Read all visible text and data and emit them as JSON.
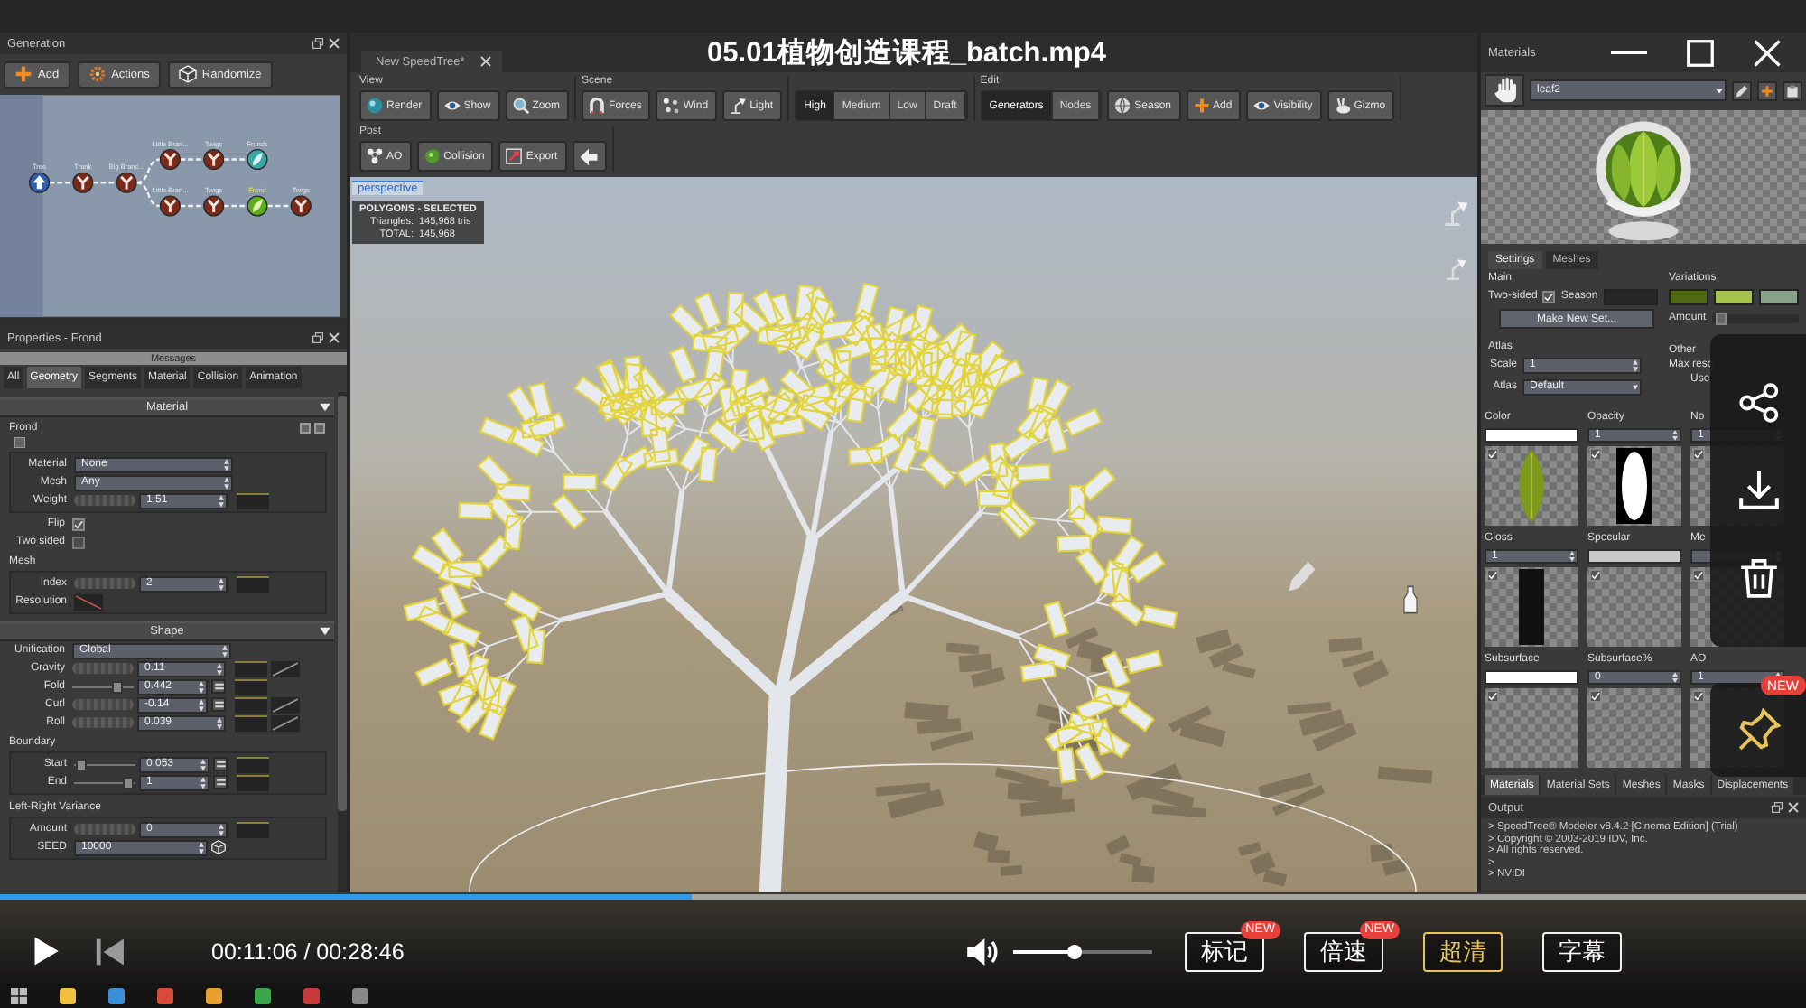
{
  "player": {
    "title": "05.01植物创造课程_batch.mp4",
    "time": "00:11:06 / 00:28:46",
    "progress": {
      "level": 0.383
    },
    "volume": {
      "level": 0.44
    },
    "buttons": [
      {
        "label": "标记",
        "badge": "NEW",
        "selected": false
      },
      {
        "label": "倍速",
        "badge": "NEW",
        "selected": false
      },
      {
        "label": "超清",
        "selected": true
      },
      {
        "label": "字幕",
        "selected": false
      }
    ],
    "pin_badge": "NEW"
  },
  "generation": {
    "title": "Generation",
    "buttons": [
      "Add",
      "Actions",
      "Randomize"
    ],
    "graph": {
      "label": "Tree",
      "kind": "root",
      "selected": false,
      "children": [
        {
          "label": "Trunk",
          "kind": "branch",
          "selected": false,
          "children": [
            {
              "label": "Big Branc...",
              "kind": "branch",
              "selected": false,
              "children": [
                {
                  "label": "Little Bran...",
                  "kind": "branch",
                  "selected": false,
                  "children": [
                    {
                      "label": "Twigs",
                      "kind": "branch",
                      "selected": false,
                      "children": [
                        {
                          "label": "Fronds",
                          "kind": "leaf",
                          "selected": false
                        }
                      ]
                    }
                  ]
                },
                {
                  "label": "Little Bran...",
                  "kind": "branch",
                  "selected": false,
                  "children": [
                    {
                      "label": "Twigs",
                      "kind": "branch",
                      "selected": false,
                      "children": [
                        {
                          "label": "Frond",
                          "kind": "frond",
                          "selected": true,
                          "children": [
                            {
                              "label": "Twigs",
                              "kind": "branch",
                              "selected": false
                            }
                          ]
                        }
                      ]
                    }
                  ]
                }
              ]
            }
          ]
        }
      ]
    }
  },
  "properties": {
    "title": "Properties - Frond",
    "messages": "Messages",
    "tabs": [
      {
        "label": "All",
        "selected": false
      },
      {
        "label": "Geometry",
        "selected": true
      },
      {
        "label": "Segments",
        "selected": false
      },
      {
        "label": "Material",
        "selected": false
      },
      {
        "label": "Collision",
        "selected": false
      },
      {
        "label": "Animation",
        "selected": false
      }
    ],
    "sections": [
      {
        "title": "Material",
        "expanded": true,
        "items": [
          {
            "kind": "group",
            "title": "Frond",
            "tools": true,
            "rows": [
              {
                "kind": "dropdown",
                "label": "Material",
                "value": "None"
              },
              {
                "kind": "dropdown",
                "label": "Mesh",
                "value": "Any"
              },
              {
                "kind": "spin",
                "label": "Weight",
                "value": "1.51",
                "link": false,
                "graph": false
              }
            ]
          },
          {
            "kind": "check",
            "label": "Flip",
            "checked": true
          },
          {
            "kind": "check",
            "label": "Two sided",
            "checked": false
          },
          {
            "kind": "group",
            "title": "Mesh",
            "tools": false,
            "rows": [
              {
                "kind": "spin",
                "label": "Index",
                "value": "2",
                "link": false,
                "graph": false
              },
              {
                "kind": "curve",
                "label": "Resolution"
              }
            ]
          }
        ]
      },
      {
        "title": "Shape",
        "expanded": true,
        "items": [
          {
            "kind": "dropdown",
            "label": "Unification",
            "value": "Global"
          },
          {
            "kind": "spin",
            "label": "Gravity",
            "value": "0.11",
            "link": false,
            "graph": true
          },
          {
            "kind": "slider",
            "label": "Fold",
            "value": "0.442",
            "level": 0.8,
            "link": true,
            "graph": false
          },
          {
            "kind": "spin",
            "label": "Curl",
            "value": "-0.14",
            "link": true,
            "graph": true
          },
          {
            "kind": "spin",
            "label": "Roll",
            "value": "0.039",
            "link": false,
            "graph": true
          },
          {
            "kind": "group",
            "title": "Boundary",
            "tools": false,
            "rows": [
              {
                "kind": "slider",
                "label": "Start",
                "value": "0.053",
                "level": 0.05,
                "link": true,
                "graph": false
              },
              {
                "kind": "slider",
                "label": "End",
                "value": "1",
                "level": 0.95,
                "link": true,
                "graph": false
              }
            ]
          },
          {
            "kind": "group",
            "title": "Left-Right Variance",
            "tools": false,
            "rows": [
              {
                "kind": "spin",
                "label": "Amount",
                "value": "0",
                "link": false,
                "graph": false
              },
              {
                "kind": "seed",
                "label": "SEED",
                "value": "10000"
              }
            ]
          }
        ]
      }
    ]
  },
  "editor": {
    "document_tab": "New SpeedTree*",
    "toolbar": [
      [
        {
          "label": "View",
          "buttons": [
            "Render",
            "Show",
            "Zoom"
          ]
        },
        {
          "label": "Scene",
          "buttons": [
            "Forces",
            "Wind",
            "Light"
          ]
        },
        {
          "segments": [
            {
              "label": "High",
              "selected": true
            },
            {
              "label": "Medium",
              "selected": false
            },
            {
              "label": "Low",
              "selected": false
            },
            {
              "label": "Draft",
              "selected": false
            }
          ]
        },
        {
          "label": "Edit",
          "segments": [
            {
              "label": "Generators",
              "selected": true
            },
            {
              "label": "Nodes",
              "selected": false
            }
          ],
          "buttons": [
            "Season",
            "Add",
            "Visibility",
            "Gizmo"
          ]
        }
      ],
      [
        {
          "label": "Post",
          "buttons": [
            "AO",
            "Collision",
            "Export"
          ]
        }
      ]
    ],
    "viewport": {
      "camera": "perspective",
      "stats_title": "POLYGONS - SELECTED",
      "stats": [
        {
          "label": "Triangles:",
          "value": "145,968 tris"
        },
        {
          "label": "TOTAL:",
          "value": "145,968"
        }
      ]
    }
  },
  "materials": {
    "title": "Materials",
    "material": "leaf2",
    "tabs": [
      {
        "label": "Settings",
        "selected": true
      },
      {
        "label": "Meshes",
        "selected": false
      }
    ],
    "main": {
      "title": "Main",
      "two_sided": {
        "label": "Two-sided",
        "checked": true
      },
      "season": {
        "label": "Season",
        "color": "#262626"
      },
      "button": "Make New Set..."
    },
    "variations": {
      "title": "Variations",
      "swatches": [
        {
          "color": "#4e6b14"
        },
        {
          "color": "#a4c34e"
        },
        {
          "color": "#86a287"
        }
      ],
      "amount": {
        "label": "Amount",
        "level": 0.06
      }
    },
    "atlas": {
      "title": "Atlas",
      "fields": [
        {
          "label": "Scale",
          "kind": "number",
          "value": "1"
        },
        {
          "label": "Atlas",
          "kind": "dropdown",
          "value": "Default"
        }
      ]
    },
    "other": {
      "title": "Other",
      "lines": [
        "Max reso",
        "Use"
      ]
    },
    "slots": [
      {
        "label": "Color",
        "kind": "color",
        "color": "#ffffff",
        "texture": {
          "kind": "leaf"
        },
        "checked": true
      },
      {
        "label": "Opacity",
        "kind": "number",
        "value": "1",
        "texture": {
          "kind": "mask"
        },
        "checked": true
      },
      {
        "label": "No",
        "kind": "number",
        "value": "1",
        "checked": true
      },
      {
        "label": "Gloss",
        "kind": "number",
        "value": "1",
        "texture": {
          "kind": "dark"
        },
        "checked": true
      },
      {
        "label": "Specular",
        "kind": "color",
        "color": "#c8c8c8",
        "checked": true
      },
      {
        "label": "Me",
        "kind": "number",
        "checked": true
      },
      {
        "label": "Subsurface",
        "kind": "color",
        "color": "#ffffff",
        "checked": true
      },
      {
        "label": "Subsurface%",
        "kind": "number",
        "value": "0",
        "checked": true
      },
      {
        "label": "AO",
        "kind": "number",
        "value": "1",
        "checked": true
      }
    ],
    "bottom_tabs": [
      {
        "label": "Materials",
        "selected": true
      },
      {
        "label": "Material Sets",
        "selected": false
      },
      {
        "label": "Meshes",
        "selected": false
      },
      {
        "label": "Masks",
        "selected": false
      },
      {
        "label": "Displacements",
        "selected": false
      }
    ]
  },
  "output": {
    "title": "Output",
    "lines": [
      "> SpeedTree® Modeler v8.4.2 [Cinema Edition] (Trial)",
      "> Copyright © 2003-2019 IDV, Inc.",
      "> All rights reserved.",
      ">",
      "> NVIDI"
    ]
  }
}
